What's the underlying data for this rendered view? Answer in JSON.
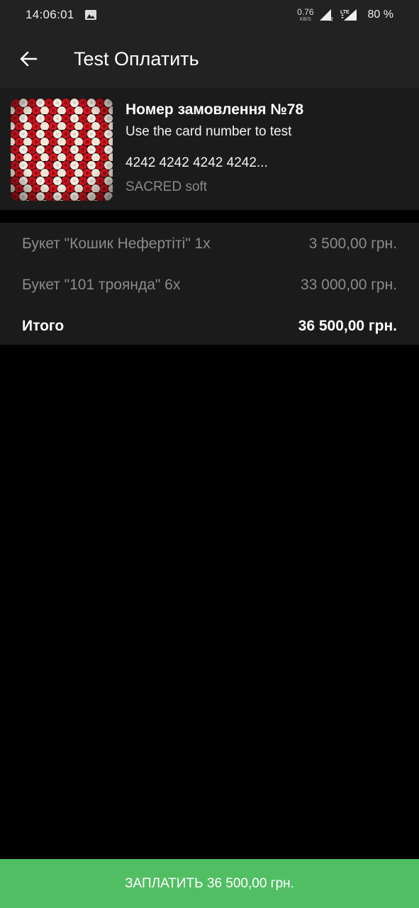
{
  "status_bar": {
    "time": "14:06:01",
    "net_speed_value": "0.76",
    "net_speed_unit": "KB/S",
    "network_type": "LTE",
    "roaming": "R",
    "battery": "80 %"
  },
  "app_bar": {
    "title": "Test Оплатить"
  },
  "order": {
    "number": "Номер замовлення №78",
    "description": "Use the card number to test",
    "card_number": "4242 4242 4242 4242...",
    "merchant": "SACRED soft"
  },
  "items": [
    {
      "name": "Букет \"Кошик Нефертіті\" 1x",
      "price": "3 500,00 грн."
    },
    {
      "name": "Букет \"101 троянда\" 6x",
      "price": "33 000,00 грн."
    }
  ],
  "total": {
    "label": "Итого",
    "price": "36 500,00 грн."
  },
  "pay_button": {
    "label": "ЗАПЛАТИТЬ 36 500,00 грн."
  },
  "colors": {
    "accent": "#52be64",
    "app_bar": "#222222",
    "card": "#1b1b1b",
    "muted_text": "#8b8b8b"
  }
}
